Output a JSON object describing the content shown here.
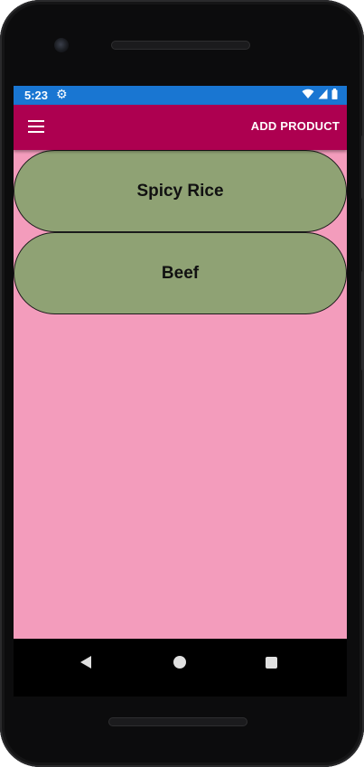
{
  "status_bar": {
    "time": "5:23",
    "settings_icon": "gear-icon",
    "icons": [
      "wifi-icon",
      "signal-icon",
      "battery-icon"
    ],
    "color": "#1976d2"
  },
  "app_bar": {
    "menu_icon": "hamburger-menu-icon",
    "action_label": "ADD PRODUCT",
    "color": "#ad0050"
  },
  "content": {
    "background": "#f39cbc",
    "products": [
      {
        "name": "Spicy Rice"
      },
      {
        "name": "Beef"
      }
    ],
    "product_color": "#8fa274"
  },
  "nav_bar": {
    "buttons": [
      "back-icon",
      "home-icon",
      "recents-icon"
    ]
  }
}
